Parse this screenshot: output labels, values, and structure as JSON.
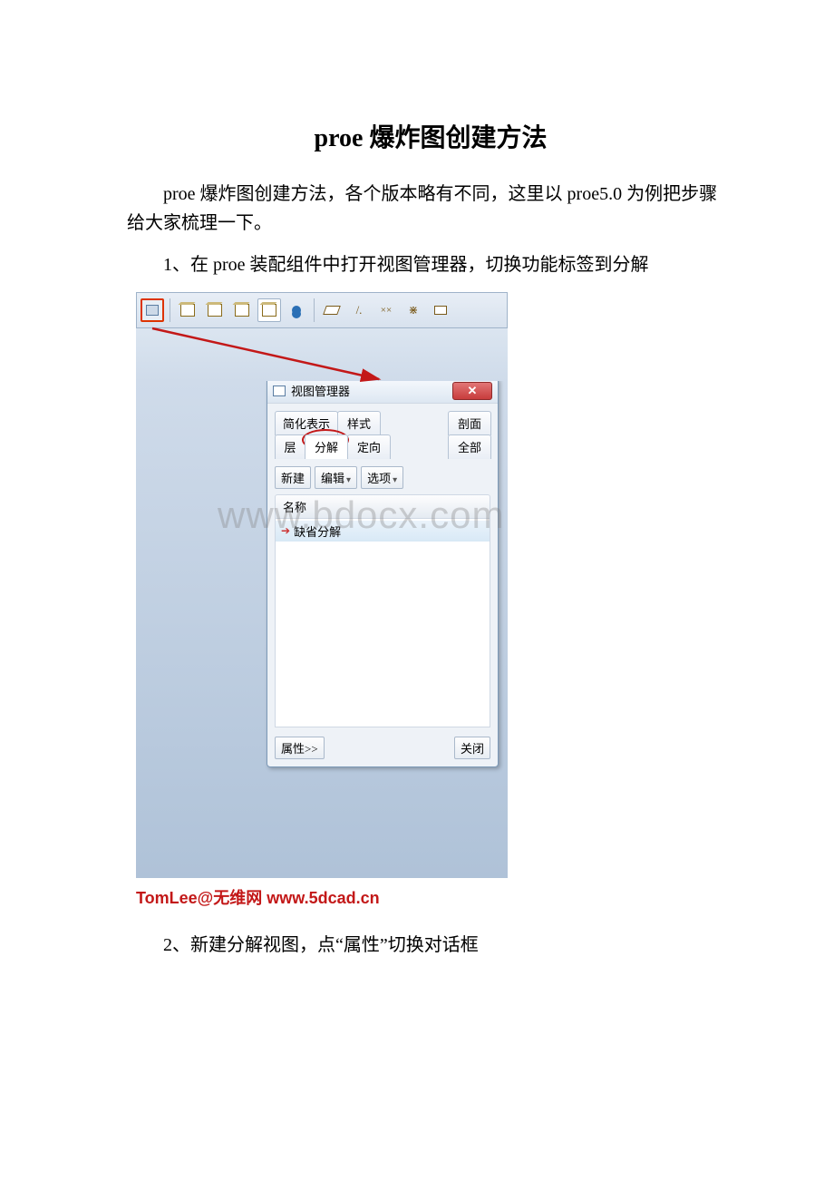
{
  "title": "proe 爆炸图创建方法",
  "para1": "proe 爆炸图创建方法，各个版本略有不同，这里以 proe5.0 为例把步骤给大家梳理一下。",
  "step1": "1、在 proe 装配组件中打开视图管理器，切换功能标签到分解",
  "dialog": {
    "title": "视图管理器",
    "close": "✕",
    "tabs_row1": [
      "简化表示",
      "样式",
      "剖面"
    ],
    "tabs_row2": [
      "层",
      "分解",
      "定向",
      "全部"
    ],
    "btn_new": "新建",
    "btn_edit": "编辑",
    "btn_options": "选项",
    "list_header": "名称",
    "list_item": "缺省分解",
    "footer_props": "属性>>",
    "footer_close": "关闭"
  },
  "watermark": "www.bdocx.com",
  "credit": "TomLee@无维网 www.5dcad.cn",
  "step2": "2、新建分解视图，点“属性”切换对话框"
}
